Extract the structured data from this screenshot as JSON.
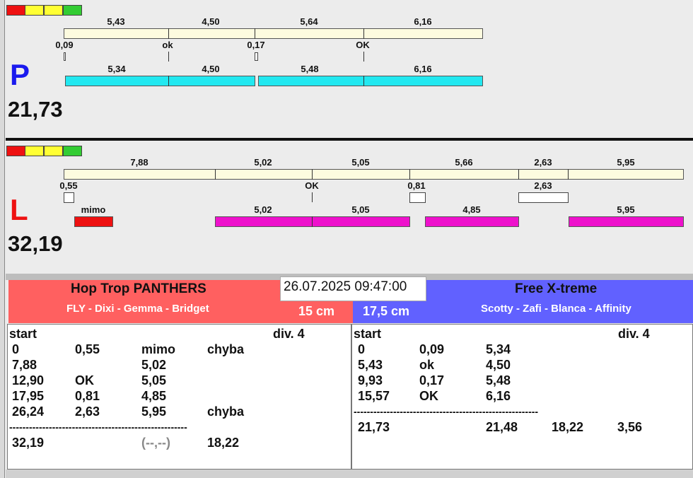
{
  "colors": {
    "red": "#ee1111",
    "yellow": "#ffff33",
    "green": "#33cc33",
    "cream": "#fdfbdf",
    "cyan": "#22e8f0",
    "magenta": "#ee11cc",
    "red_bar": "#ee1111",
    "team_left_bg": "#ff6060",
    "team_right_bg": "#6161ff"
  },
  "top": {
    "letter": "P",
    "total": "21,73",
    "seg_labels": [
      "5,43",
      "4,50",
      "5,64",
      "6,16"
    ],
    "mark_labels": [
      "0,09",
      "ok",
      "0,17",
      "OK"
    ],
    "run_labels": [
      "5,34",
      "4,50",
      "5,48",
      "6,16"
    ]
  },
  "bottom": {
    "letter": "L",
    "total": "32,19",
    "seg_labels": [
      "7,88",
      "5,02",
      "5,05",
      "5,66",
      "2,63",
      "5,95"
    ],
    "mark_labels": [
      "0,55",
      "OK",
      "0,81",
      "2,63"
    ],
    "run_labels": [
      "mimo",
      "5,02",
      "5,05",
      "4,85",
      "5,95"
    ]
  },
  "datetime": "26.07.2025 09:47:00",
  "team_left": {
    "name": "Hop Trop PANTHERS",
    "dogs": "FLY - Dixi - Gemma - Bridget",
    "height": "15 cm"
  },
  "team_right": {
    "name": "Free X-treme",
    "dogs": "Scotty - Zafi - Blanca - Affinity",
    "height": "17,5 cm"
  },
  "left_table": {
    "start": "start",
    "div": "div.  4",
    "rows": [
      [
        "0",
        "0,55",
        "mimo",
        "chyba"
      ],
      [
        "7,88",
        "",
        "5,02",
        ""
      ],
      [
        "12,90",
        "OK",
        "5,05",
        ""
      ],
      [
        "17,95",
        "0,81",
        "4,85",
        ""
      ],
      [
        "26,24",
        "2,63",
        "5,95",
        "chyba"
      ]
    ],
    "dashes": "------------------------------------------------------",
    "totals": [
      "32,19",
      "",
      "(--,--)",
      "18,22"
    ]
  },
  "right_table": {
    "start": "start",
    "div": "div.  4",
    "rows": [
      [
        "0",
        "0,09",
        "5,34"
      ],
      [
        "5,43",
        "ok",
        "4,50"
      ],
      [
        "9,93",
        "0,17",
        "5,48"
      ],
      [
        "15,57",
        "OK",
        "6,16"
      ]
    ],
    "dashes": "--------------------------------------------------------",
    "totals": [
      "21,73",
      "",
      "21,48",
      "18,22",
      "3,56"
    ]
  }
}
